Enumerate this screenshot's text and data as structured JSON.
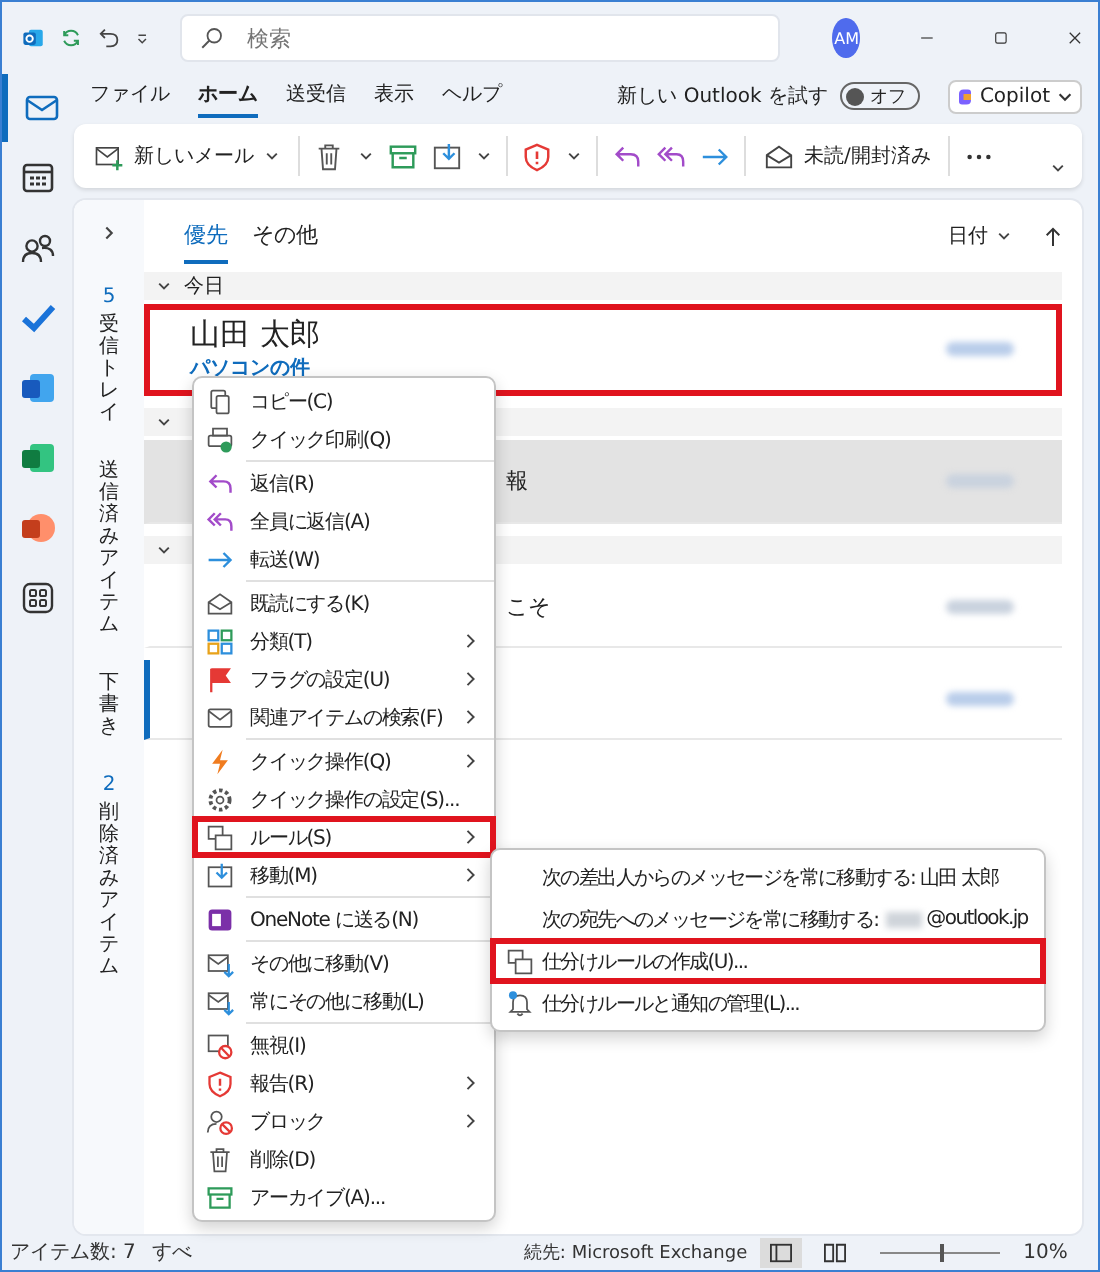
{
  "window": {
    "search_placeholder": "検索",
    "avatar": "AM"
  },
  "ribbon_tabs": [
    {
      "label": "ファイル",
      "selected": false
    },
    {
      "label": "ホーム",
      "selected": true
    },
    {
      "label": "送受信",
      "selected": false
    },
    {
      "label": "表示",
      "selected": false
    },
    {
      "label": "ヘルプ",
      "selected": false
    }
  ],
  "new_outlook": {
    "label": "新しい Outlook を試す",
    "toggle_label": "オフ",
    "on": false
  },
  "copilot": {
    "label": "Copilot"
  },
  "toolbar": {
    "new_mail": "新しいメール",
    "read_unread": "未読/開封済み"
  },
  "folders": [
    {
      "name": "受信トレイ",
      "count": "5"
    },
    {
      "name": "送信済みアイテム"
    },
    {
      "name": "下書き"
    },
    {
      "name": "削除済みアイテム",
      "count": "2"
    }
  ],
  "mail_tabs": [
    {
      "label": "優先",
      "selected": true
    },
    {
      "label": "その他",
      "selected": false
    }
  ],
  "sort": {
    "label": "日付"
  },
  "mail_list": [
    {
      "kind": "group",
      "label": "今日"
    },
    {
      "kind": "message",
      "sender": "山田 太郎",
      "subject": "パソコンの件",
      "selected": false,
      "highlighted": true,
      "unread": false
    },
    {
      "kind": "group"
    },
    {
      "kind": "message",
      "preview": "報",
      "selected": true,
      "highlighted": false,
      "unread": false
    },
    {
      "kind": "group"
    },
    {
      "kind": "message",
      "preview": "こそ",
      "selected": false,
      "highlighted": false,
      "unread": false
    },
    {
      "kind": "message",
      "selected": false,
      "highlighted": false,
      "unread": true
    }
  ],
  "context_menu": [
    [
      {
        "label": "コピー(C)",
        "has_submenu": false,
        "highlighted": false
      },
      {
        "label": "クイック印刷(Q)",
        "has_submenu": false,
        "highlighted": false
      }
    ],
    [
      {
        "label": "返信(R)",
        "has_submenu": false,
        "highlighted": false
      },
      {
        "label": "全員に返信(A)",
        "has_submenu": false,
        "highlighted": false
      },
      {
        "label": "転送(W)",
        "has_submenu": false,
        "highlighted": false
      }
    ],
    [
      {
        "label": "既読にする(K)",
        "has_submenu": false,
        "highlighted": false
      },
      {
        "label": "分類(T)",
        "has_submenu": true,
        "highlighted": false
      },
      {
        "label": "フラグの設定(U)",
        "has_submenu": true,
        "highlighted": false
      },
      {
        "label": "関連アイテムの検索(F)",
        "has_submenu": true,
        "highlighted": false
      }
    ],
    [
      {
        "label": "クイック操作(Q)",
        "has_submenu": true,
        "highlighted": false
      },
      {
        "label": "クイック操作の設定(S)...",
        "has_submenu": false,
        "highlighted": false
      },
      {
        "label": "ルール(S)",
        "has_submenu": true,
        "highlighted": true
      },
      {
        "label": "移動(M)",
        "has_submenu": true,
        "highlighted": false
      }
    ],
    [
      {
        "label": "OneNote に送る(N)",
        "has_submenu": false,
        "highlighted": false
      }
    ],
    [
      {
        "label": "その他に移動(V)",
        "has_submenu": false,
        "highlighted": false
      },
      {
        "label": "常にその他に移動(L)",
        "has_submenu": false,
        "highlighted": false
      }
    ],
    [
      {
        "label": "無視(I)",
        "has_submenu": false,
        "highlighted": false
      },
      {
        "label": "報告(R)",
        "has_submenu": true,
        "highlighted": false
      },
      {
        "label": "ブロック",
        "has_submenu": true,
        "highlighted": false
      },
      {
        "label": "削除(D)",
        "has_submenu": false,
        "highlighted": false
      },
      {
        "label": "アーカイブ(A)...",
        "has_submenu": false,
        "highlighted": false
      }
    ]
  ],
  "submenu": [
    {
      "label": "次の差出人からのメッセージを常に移動する: 山田 太郎",
      "redacted": false,
      "highlighted": false
    },
    {
      "label": "次の宛先へのメッセージを常に移動する:",
      "redacted": true,
      "suffix": "@outlook.jp",
      "highlighted": false
    },
    {
      "label": "仕分けルールの作成(U)...",
      "redacted": false,
      "highlighted": true
    },
    {
      "label": "仕分けルールと通知の管理(L)...",
      "redacted": false,
      "highlighted": false
    }
  ],
  "status_bar": {
    "items": "アイテム数: 7",
    "filter": "すべ",
    "connection": "続先: Microsoft Exchange",
    "zoom_slider": {
      "level": 0.5
    },
    "zoom": "10%"
  }
}
